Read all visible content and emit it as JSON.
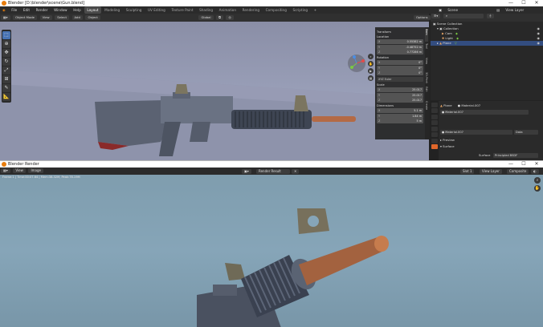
{
  "window1": {
    "title": "Blender [D:\\blender\\scene\\Gun.blend]",
    "controls": {
      "minimize": "—",
      "maximize": "☐",
      "close": "✕"
    },
    "menus": [
      "File",
      "Edit",
      "Render",
      "Window",
      "Help"
    ],
    "workspaces": [
      "Layout",
      "Modeling",
      "Sculpting",
      "UV Editing",
      "Texture Paint",
      "Shading",
      "Animation",
      "Rendering",
      "Compositing",
      "Scripting",
      "+"
    ],
    "active_workspace": "Layout",
    "scene": "Scene",
    "view_layer": "View Layer",
    "viewport_header": {
      "mode": "Object Mode",
      "menus": [
        "View",
        "Select",
        "Add",
        "Object"
      ],
      "orientation": "Global",
      "options": "Options"
    },
    "npanel": {
      "transform_title": "Transform",
      "location_label": "Location",
      "location": [
        [
          "X",
          "0.55382 m"
        ],
        [
          "Y",
          "-0.48752 m"
        ],
        [
          "Z",
          "0.77286 m"
        ]
      ],
      "rotation_label": "Rotation",
      "rotation": [
        [
          "X",
          "0°"
        ],
        [
          "Y",
          "0°"
        ],
        [
          "Z",
          "0°"
        ]
      ],
      "rotation_mode": "XYZ Euler",
      "scale_label": "Scale",
      "scale": [
        [
          "X",
          "25.017"
        ],
        [
          "Y",
          "25.017"
        ],
        [
          "Z",
          "25.017"
        ]
      ],
      "dimensions_label": "Dimensions",
      "dimensions": [
        [
          "X",
          "5.1 m"
        ],
        [
          "Y",
          "1.84 m"
        ],
        [
          "Z",
          "5 m"
        ]
      ],
      "tabs": [
        "Item",
        "Tool",
        "View",
        "3D-Print",
        "Edit",
        "Create"
      ]
    },
    "outliner": {
      "items": [
        {
          "label": "Scene Collection",
          "indent": 0
        },
        {
          "label": "Collection",
          "indent": 1
        },
        {
          "label": "Cam",
          "indent": 2
        },
        {
          "label": "Light",
          "indent": 2
        },
        {
          "label": "Plane",
          "indent": 1
        }
      ]
    },
    "properties": {
      "object": "Plane",
      "material_tab": "Material.007",
      "slot": "Material.007",
      "material_field": "Material.007",
      "data_label": "Data",
      "sections": [
        "Preview",
        "Surface"
      ],
      "surface_label": "Surface",
      "surface_value": "Principled BSDF"
    }
  },
  "window2": {
    "title": "Blender Render",
    "controls": {
      "minimize": "—",
      "maximize": "☐",
      "close": "✕"
    },
    "menus": [
      "View",
      "Image"
    ],
    "slot_label": "Render Result",
    "slot": "Slot 1",
    "view_layer": "View Layer",
    "pass": "Composite",
    "meta": "Frame:1 | Time:00:07.64 | Mem:38.32M, Peak:78.19M"
  },
  "colors": {
    "accent": "#4772b3",
    "active_tab": "#e0672b",
    "viewport_bg": "#9aa0b9",
    "render_bg": "#86a5b8"
  }
}
